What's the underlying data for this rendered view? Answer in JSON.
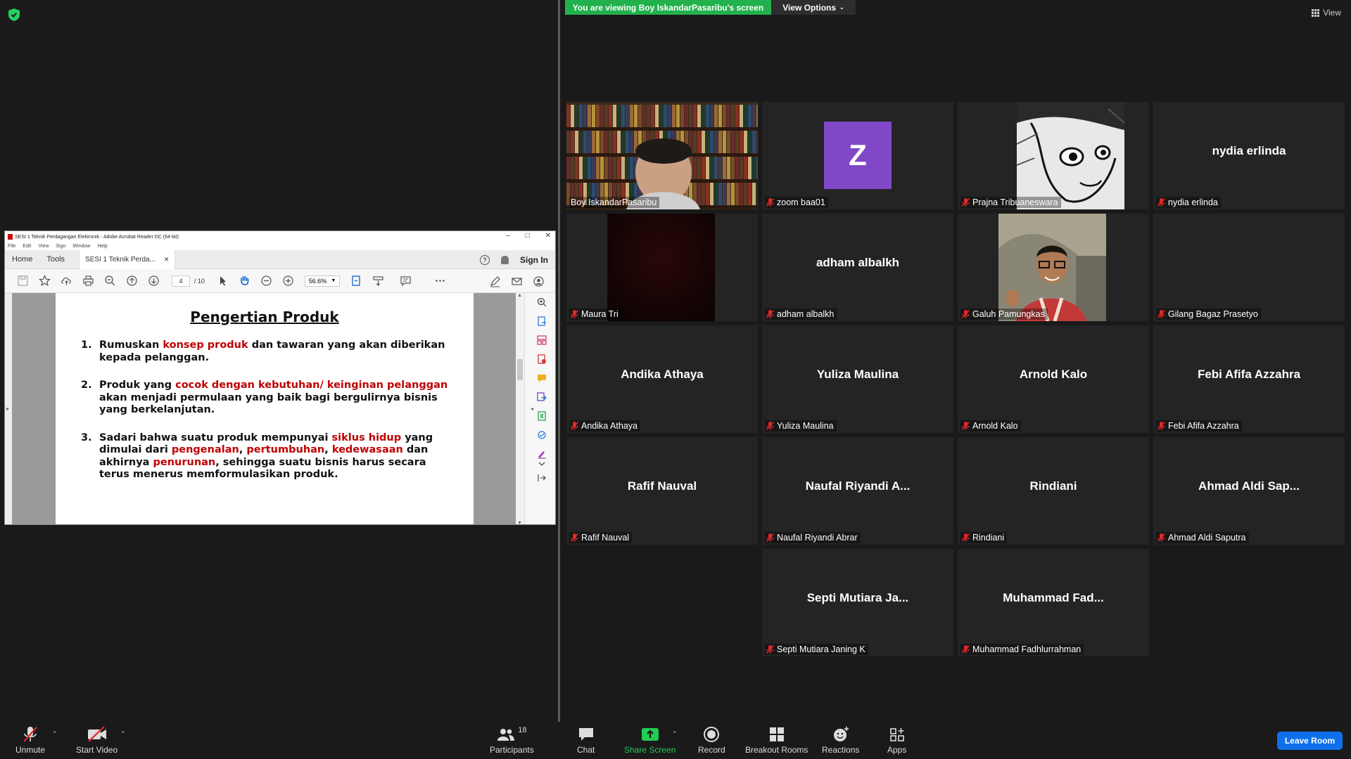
{
  "banner": {
    "viewing_text": "You are viewing Boy IskandarPasaribu's screen",
    "view_options": "View Options",
    "view_label": "View"
  },
  "acrobat": {
    "title": "SESI 1  Teknik Perdagangan Elektronik - Adobe Acrobat Reader DC (64-bit)",
    "menu": [
      "File",
      "Edit",
      "View",
      "Sign",
      "Window",
      "Help"
    ],
    "tab_home": "Home",
    "tab_tools": "Tools",
    "doc_tab": "SESI 1  Teknik Perda...",
    "sign_in": "Sign In",
    "page_current": "4",
    "page_total": "/ 10",
    "zoom": "56.6%",
    "page_title": "Pengertian Produk",
    "items": [
      {
        "num": "1.",
        "parts": [
          {
            "t": "Rumuskan ",
            "red": false
          },
          {
            "t": "konsep produk",
            "red": true
          },
          {
            "t": " dan tawaran yang akan diberikan kepada pelanggan.",
            "red": false
          }
        ]
      },
      {
        "num": "2.",
        "parts": [
          {
            "t": "Produk yang ",
            "red": false
          },
          {
            "t": "cocok dengan kebutuhan/ keinginan pelanggan",
            "red": true
          },
          {
            "t": " akan menjadi permulaan yang baik bagi bergulirnya bisnis yang berkelanjutan.",
            "red": false
          }
        ]
      },
      {
        "num": "3.",
        "parts": [
          {
            "t": "Sadari bahwa suatu produk mempunyai ",
            "red": false
          },
          {
            "t": "siklus hidup",
            "red": true
          },
          {
            "t": " yang dimulai dari ",
            "red": false
          },
          {
            "t": "pengenalan",
            "red": true
          },
          {
            "t": ", ",
            "red": false
          },
          {
            "t": "pertumbuhan",
            "red": true
          },
          {
            "t": ", ",
            "red": false
          },
          {
            "t": "kedewasaan",
            "red": true
          },
          {
            "t": " dan akhirnya ",
            "red": false
          },
          {
            "t": "penurunan",
            "red": true
          },
          {
            "t": ", sehingga suatu bisnis harus secara terus menerus memformulasikan produk.",
            "red": false
          }
        ]
      }
    ]
  },
  "participants": [
    {
      "name": "Boy IskandarPasaribu",
      "display": "",
      "type": "video-books",
      "active": true,
      "muted": false
    },
    {
      "name": "zoom baa01",
      "display": "",
      "type": "avatar",
      "avatar_letter": "Z",
      "muted": true
    },
    {
      "name": "Prajna Tribuaneswara",
      "display": "",
      "type": "video-manga",
      "muted": true
    },
    {
      "name": "nydia erlinda",
      "display": "nydia erlinda",
      "type": "name",
      "muted": true
    },
    {
      "name": "Maura Tri",
      "display": "",
      "type": "video-dark",
      "muted": true
    },
    {
      "name": "adham albalkh",
      "display": "adham albalkh",
      "type": "name",
      "muted": true
    },
    {
      "name": "Galuh Pamungkas",
      "display": "",
      "type": "video-person",
      "muted": true
    },
    {
      "name": "Gilang Bagaz Prasetyo",
      "display": "",
      "type": "blank",
      "muted": true
    },
    {
      "name": "Andika Athaya",
      "display": "Andika Athaya",
      "type": "name",
      "muted": true
    },
    {
      "name": "Yuliza Maulina",
      "display": "Yuliza Maulina",
      "type": "name",
      "muted": true
    },
    {
      "name": "Arnold Kalo",
      "display": "Arnold Kalo",
      "type": "name",
      "muted": true
    },
    {
      "name": "Febi Afifa Azzahra",
      "display": "Febi Afifa Azzahra",
      "type": "name",
      "muted": true
    },
    {
      "name": "Rafif Nauval",
      "display": "Rafif Nauval",
      "type": "name",
      "muted": true
    },
    {
      "name": "Naufal Riyandi Abrar",
      "display": "Naufal  Riyandi  A...",
      "type": "name",
      "muted": true
    },
    {
      "name": "Rindiani",
      "display": "Rindiani",
      "type": "name",
      "muted": true
    },
    {
      "name": "Ahmad Aldi Saputra",
      "display": "Ahmad  Aldi  Sap...",
      "type": "name",
      "muted": true
    },
    {
      "name": "Septi Mutiara Janing K",
      "display": "Septi Mutiara Ja...",
      "type": "name",
      "muted": true
    },
    {
      "name": "Muhammad Fadhlurrahman",
      "display": "Muhammad  Fad...",
      "type": "name",
      "muted": true
    }
  ],
  "toolbar": {
    "unmute": "Unmute",
    "start_video": "Start Video",
    "participants": "Participants",
    "participants_count": "18",
    "chat": "Chat",
    "share_screen": "Share Screen",
    "record": "Record",
    "breakout_rooms": "Breakout Rooms",
    "reactions": "Reactions",
    "apps": "Apps",
    "leave_room": "Leave Room"
  },
  "colors": {
    "banner_green": "#22b14c",
    "active_border": "#e8f060",
    "mute_red": "#e02828",
    "leave_blue": "#0e71eb",
    "acrobat_red_text": "#c00000",
    "avatar_purple": "#8048c7"
  }
}
